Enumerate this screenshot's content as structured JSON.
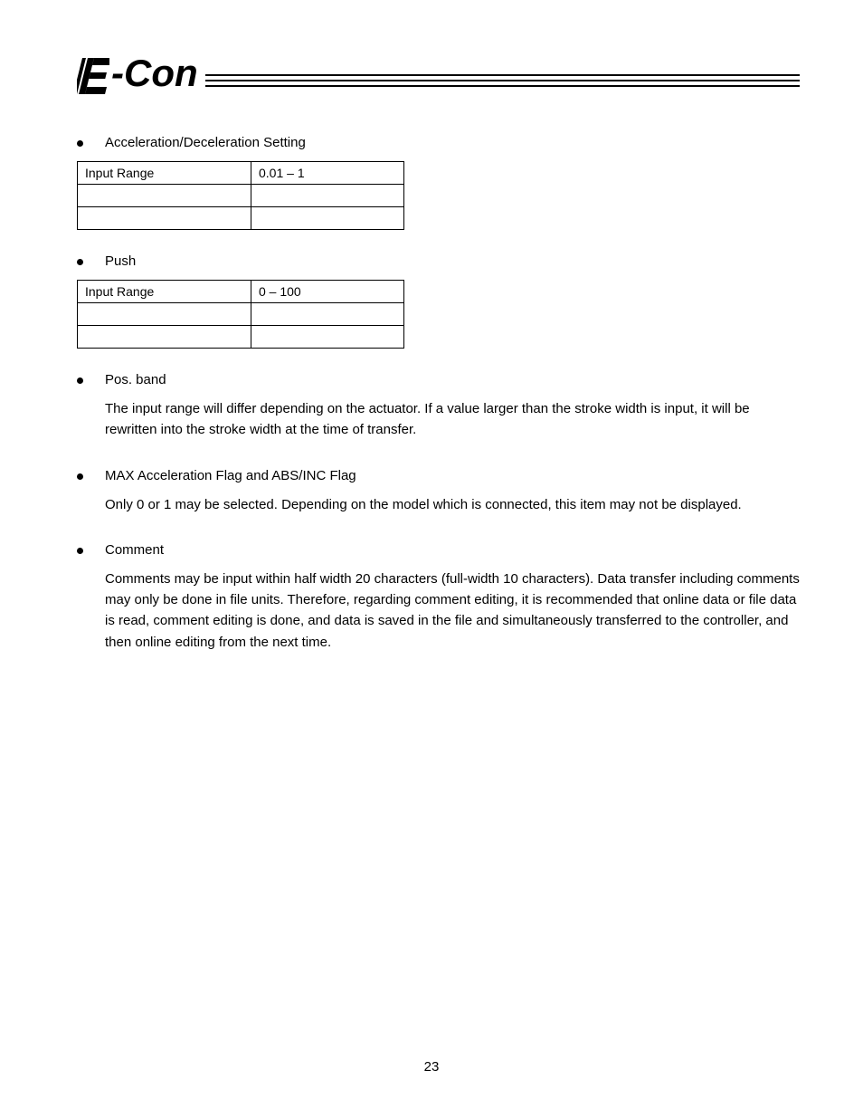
{
  "logo": {
    "text": "-Con"
  },
  "sections": [
    {
      "title": "Acceleration/Deceleration Setting",
      "table": {
        "label": "Input Range",
        "range": "0.01 – 1"
      },
      "para": null
    },
    {
      "title": "Push",
      "table": {
        "label": "Input Range",
        "range": "0 – 100"
      },
      "para": null
    },
    {
      "title": "Pos. band",
      "table": null,
      "para": "The input range will differ depending on the actuator. If a value larger than the stroke width is input, it will be rewritten into the stroke width at the time of transfer."
    },
    {
      "title": "MAX Acceleration Flag and ABS/INC Flag",
      "table": null,
      "para": "Only 0 or 1 may be selected. Depending on the model which is connected, this item may not be displayed."
    },
    {
      "title": "Comment",
      "table": null,
      "para": "Comments may be input within half width 20 characters (full-width 10 characters). Data transfer including comments may only be done in file units. Therefore, regarding comment editing, it is recommended that online data or file data is read, comment editing is done, and data is saved in the file and simultaneously transferred to the controller, and then online editing from the next time."
    }
  ],
  "pageNumber": "23"
}
